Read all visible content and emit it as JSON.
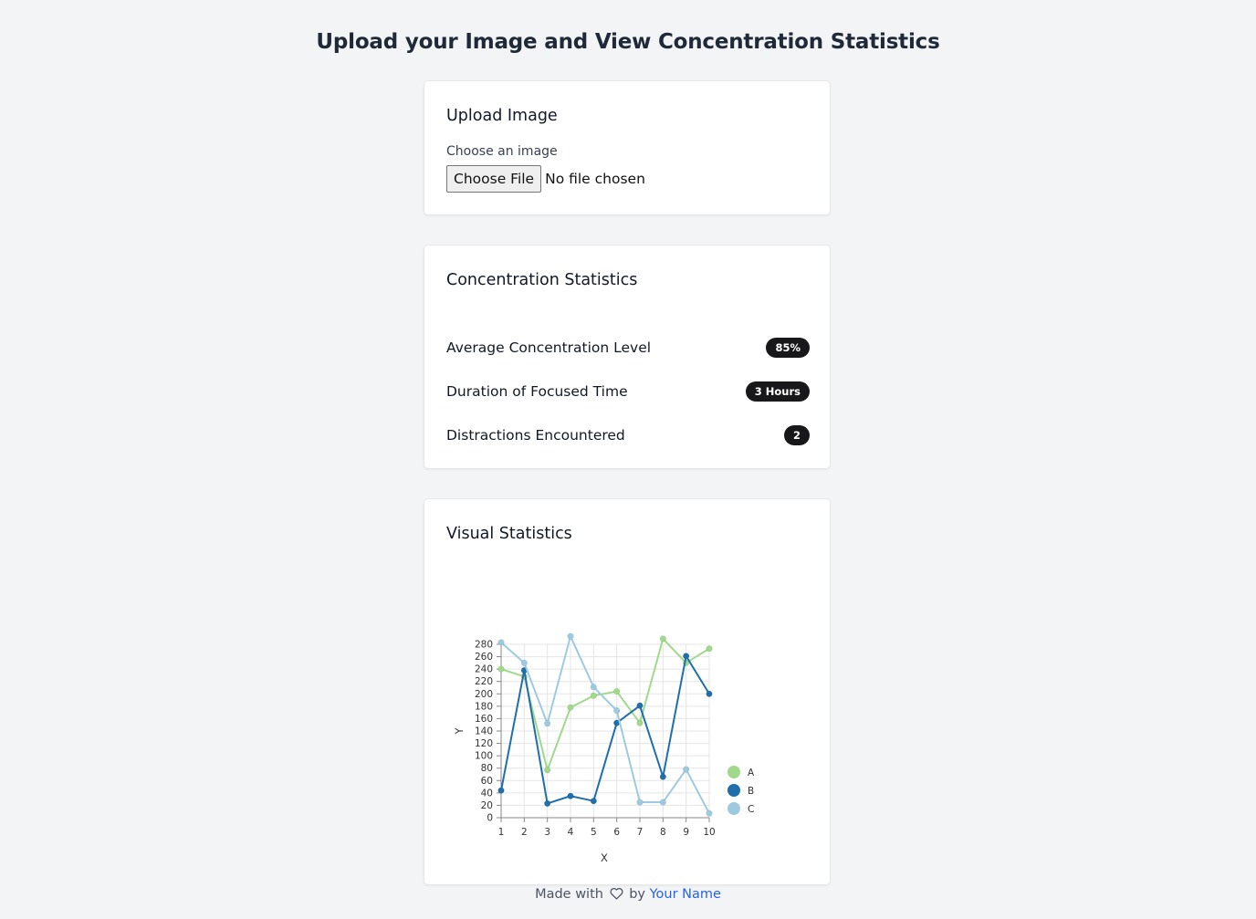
{
  "page": {
    "title": "Upload your Image and View Concentration Statistics"
  },
  "upload": {
    "title": "Upload Image",
    "field_label": "Choose an image",
    "button_label": "Choose File",
    "status_text": "No file chosen"
  },
  "stats": {
    "title": "Concentration Statistics",
    "items": [
      {
        "label": "Average Concentration Level",
        "value": "85%"
      },
      {
        "label": "Duration of Focused Time",
        "value": "3 Hours"
      },
      {
        "label": "Distractions Encountered",
        "value": "2"
      }
    ]
  },
  "visual": {
    "title": "Visual Statistics"
  },
  "chart_data": {
    "type": "line",
    "x": [
      1,
      2,
      3,
      4,
      5,
      6,
      7,
      8,
      9,
      10
    ],
    "xlabel": "X",
    "ylabel": "Y",
    "ylim": [
      0,
      280
    ],
    "yticks": [
      0,
      20,
      40,
      60,
      80,
      100,
      120,
      140,
      160,
      180,
      200,
      220,
      240,
      260,
      280
    ],
    "grid": true,
    "legend_position": "right-bottom",
    "series": [
      {
        "name": "A",
        "color": "#a1d98b",
        "values": [
          240,
          228,
          77,
          178,
          197,
          204,
          153,
          289,
          250,
          273
        ]
      },
      {
        "name": "B",
        "color": "#1f6fad",
        "values": [
          44,
          238,
          23,
          35,
          27,
          153,
          181,
          66,
          261,
          200
        ]
      },
      {
        "name": "C",
        "color": "#9ecae1",
        "values": [
          283,
          250,
          152,
          293,
          211,
          173,
          25,
          25,
          78,
          7
        ]
      }
    ]
  },
  "footer": {
    "prefix": "Made with",
    "by": "by",
    "author": "Your Name",
    "icon": "heart-icon"
  }
}
